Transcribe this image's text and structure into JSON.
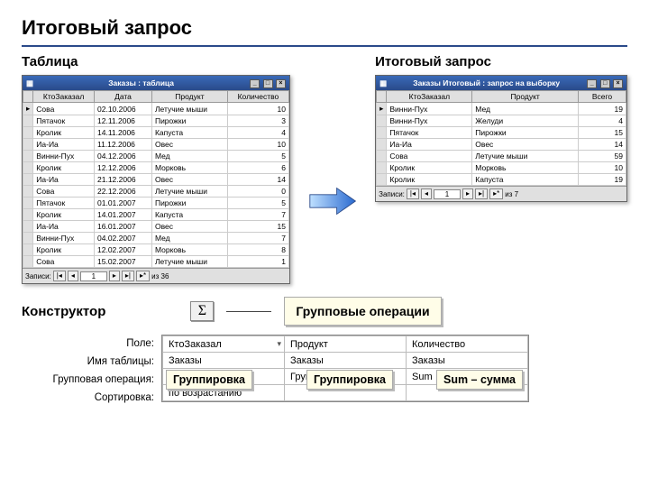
{
  "title": "Итоговый запрос",
  "labels": {
    "table": "Таблица",
    "query": "Итоговый запрос",
    "constructor": "Конструктор",
    "group_ops": "Групповые операции",
    "grouping": "Группировка",
    "sum": "Sum – сумма"
  },
  "left_window": {
    "title": "Заказы : таблица",
    "columns": [
      "КтоЗаказал",
      "Дата",
      "Продукт",
      "Количество"
    ],
    "rows": [
      [
        "Сова",
        "02.10.2006",
        "Летучие мыши",
        "10"
      ],
      [
        "Пятачок",
        "12.11.2006",
        "Пирожки",
        "3"
      ],
      [
        "Кролик",
        "14.11.2006",
        "Капуста",
        "4"
      ],
      [
        "Иа-Иа",
        "11.12.2006",
        "Овес",
        "10"
      ],
      [
        "Винни-Пух",
        "04.12.2006",
        "Мед",
        "5"
      ],
      [
        "Кролик",
        "12.12.2006",
        "Морковь",
        "6"
      ],
      [
        "Иа-Иа",
        "21.12.2006",
        "Овес",
        "14"
      ],
      [
        "Сова",
        "22.12.2006",
        "Летучие мыши",
        "0"
      ],
      [
        "Пятачок",
        "01.01.2007",
        "Пирожки",
        "5"
      ],
      [
        "Кролик",
        "14.01.2007",
        "Капуста",
        "7"
      ],
      [
        "Иа-Иа",
        "16.01.2007",
        "Овес",
        "15"
      ],
      [
        "Винни-Пух",
        "04.02.2007",
        "Мед",
        "7"
      ],
      [
        "Кролик",
        "12.02.2007",
        "Морковь",
        "8"
      ],
      [
        "Сова",
        "15.02.2007",
        "Летучие мыши",
        "1"
      ]
    ],
    "nav": {
      "label": "Записи:",
      "pos": "1",
      "total": "из 36"
    }
  },
  "right_window": {
    "title": "Заказы Итоговый : запрос на выборку",
    "columns": [
      "КтоЗаказал",
      "Продукт",
      "Всего"
    ],
    "rows": [
      [
        "Винни-Пух",
        "Мед",
        "19"
      ],
      [
        "Винни-Пух",
        "Желуди",
        "4"
      ],
      [
        "Пятачок",
        "Пирожки",
        "15"
      ],
      [
        "Иа-Иа",
        "Овес",
        "14"
      ],
      [
        "Сова",
        "Летучие мыши",
        "59"
      ],
      [
        "Кролик",
        "Морковь",
        "10"
      ],
      [
        "Кролик",
        "Капуста",
        "19"
      ]
    ],
    "nav": {
      "label": "Записи:",
      "pos": "1",
      "total": "из 7"
    }
  },
  "sigma": "Σ",
  "designer": {
    "row_labels": [
      "Поле:",
      "Имя таблицы:",
      "Групповая операция:",
      "Сортировка:"
    ],
    "cols": [
      [
        "КтоЗаказал",
        "Заказы",
        "Группировка",
        "по возрастанию"
      ],
      [
        "Продукт",
        "Заказы",
        "Группировка",
        ""
      ],
      [
        "Количество",
        "Заказы",
        "Sum",
        ""
      ]
    ]
  }
}
